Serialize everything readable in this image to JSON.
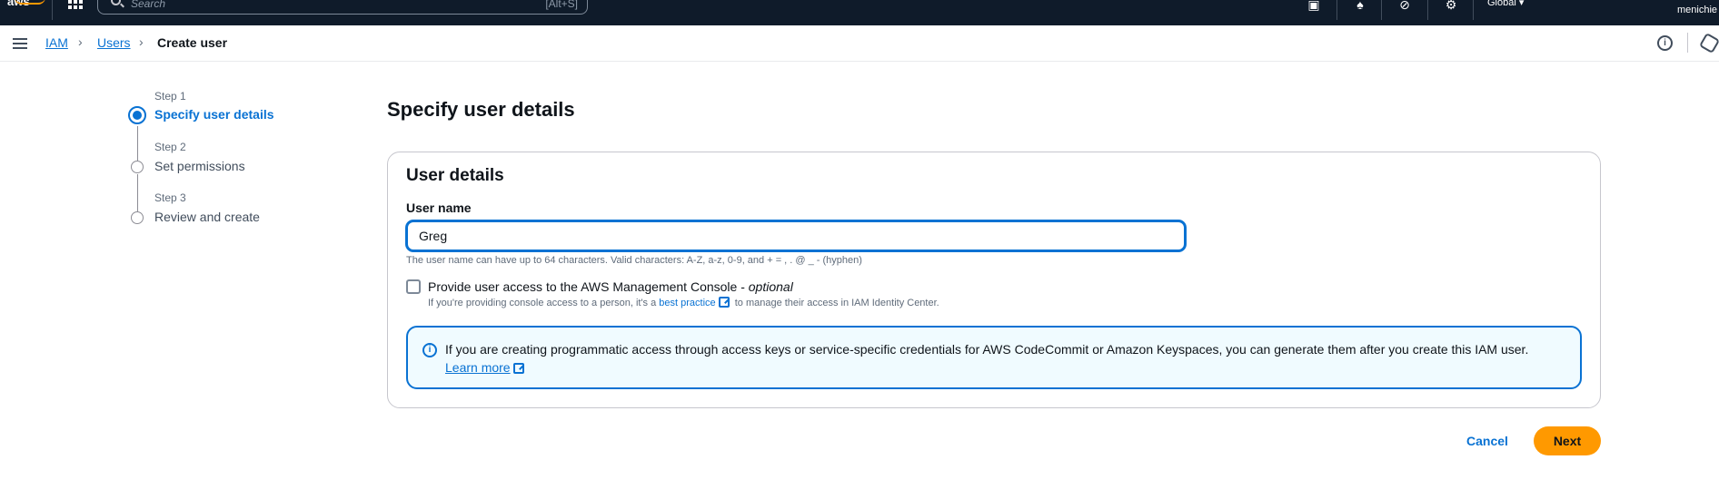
{
  "topbar": {
    "logo": "aws",
    "search_placeholder": "Search",
    "search_shortcut": "[Alt+S]",
    "region": "Global ▾",
    "account": "menichie",
    "icons": [
      "grid-icon",
      "cloudshell-icon",
      "bell-icon",
      "help-icon",
      "gear-icon"
    ]
  },
  "breadcrumb": {
    "items": [
      "IAM",
      "Users",
      "Create user"
    ]
  },
  "steps": [
    {
      "label": "Step 1",
      "title": "Specify user details",
      "active": true
    },
    {
      "label": "Step 2",
      "title": "Set permissions",
      "active": false
    },
    {
      "label": "Step 3",
      "title": "Review and create",
      "active": false
    }
  ],
  "main": {
    "page_title": "Specify user details",
    "panel_title": "User details",
    "username_label": "User name",
    "username_value": "Greg",
    "username_hint": "The user name can have up to 64 characters. Valid characters: A-Z, a-z, 0-9, and + = , . @ _ - (hyphen)",
    "console_access_label": "Provide user access to the AWS Management Console - ",
    "console_access_optional": "optional",
    "console_access_desc_before": "If you're providing console access to a person, it's a ",
    "console_access_desc_link": "best practice",
    "console_access_desc_after": " to manage their access in IAM Identity Center.",
    "alert_text": "If you are creating programmatic access through access keys or service-specific credentials for AWS CodeCommit or Amazon Keyspaces, you can generate them after you create this IAM user.",
    "alert_link": "Learn more"
  },
  "actions": {
    "cancel": "Cancel",
    "next": "Next"
  },
  "colors": {
    "accent": "#0972d3",
    "primary_button": "#ff9900",
    "topbar": "#0f1b2a"
  }
}
